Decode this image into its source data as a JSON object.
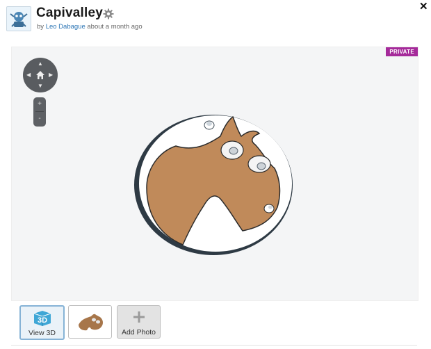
{
  "header": {
    "title": "Capivalley",
    "byline_prefix": "by",
    "author": "Leo Dabague",
    "time_ago": "about a month ago"
  },
  "viewer": {
    "badge": "PRIVATE",
    "zoom_in": "+",
    "zoom_out": "-"
  },
  "thumbnails": [
    {
      "label": "View 3D",
      "icon": "view-3d-icon",
      "selected": true
    },
    {
      "label": "",
      "icon": "model-thumbnail"
    },
    {
      "label": "Add Photo",
      "icon": "plus-icon"
    }
  ],
  "colors": {
    "accent_link": "#2a74b4",
    "badge": "#a52a9a",
    "model_body": "#c08a5a",
    "model_disc": "#ffffff"
  }
}
